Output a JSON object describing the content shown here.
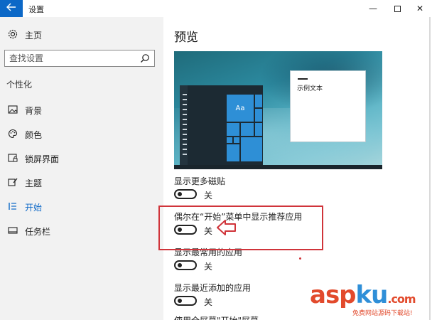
{
  "window": {
    "title": "设置",
    "back_icon": "arrow-left-icon",
    "minimize_glyph": "—",
    "close_glyph": "✕",
    "accent": "#0c68c7"
  },
  "sidebar": {
    "home_label": "主页",
    "search_placeholder": "查找设置",
    "section_label": "个性化",
    "items": [
      {
        "label": "背景",
        "icon": "picture-icon",
        "active": false
      },
      {
        "label": "颜色",
        "icon": "palette-icon",
        "active": false
      },
      {
        "label": "锁屏界面",
        "icon": "lock-screen-icon",
        "active": false
      },
      {
        "label": "主题",
        "icon": "theme-icon",
        "active": false
      },
      {
        "label": "开始",
        "icon": "start-icon",
        "active": true
      },
      {
        "label": "任务栏",
        "icon": "taskbar-icon",
        "active": false
      }
    ]
  },
  "main": {
    "title": "预览",
    "preview": {
      "tile_text": "Aa",
      "sample_text": "示例文本"
    },
    "settings": [
      {
        "label": "显示更多磁贴",
        "state": "关"
      },
      {
        "label": "偶尔在“开始”菜单中显示推荐应用",
        "state": "关"
      },
      {
        "label": "显示最常用的应用",
        "state": "关"
      },
      {
        "label": "显示最近添加的应用",
        "state": "关"
      }
    ],
    "cut_label": "使用全屏幕\"开始\"屏幕"
  },
  "annotation": {
    "highlight_color": "#d0343a"
  },
  "watermark": {
    "main_red": "asp",
    "main_blue": "ku",
    "main_suffix": ".com",
    "sub": "免费网站源码下载站!"
  }
}
